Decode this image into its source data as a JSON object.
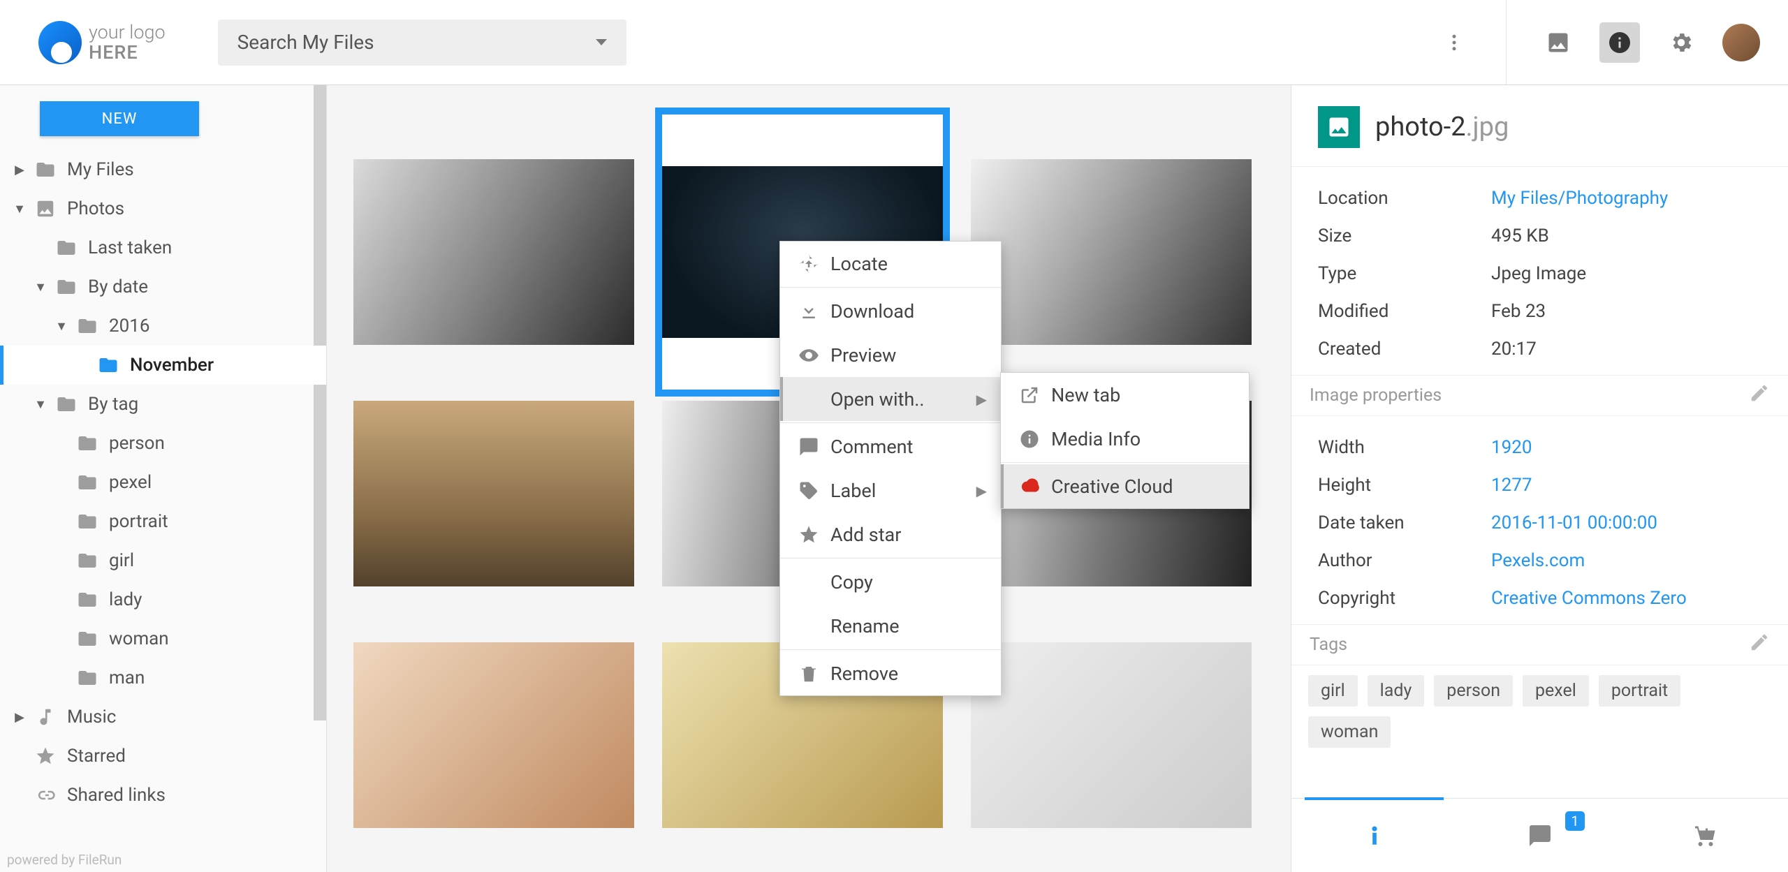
{
  "header": {
    "logo_top": "your logo",
    "logo_bottom": "HERE",
    "search_placeholder": "Search My Files"
  },
  "sidebar": {
    "new_label": "NEW",
    "items": {
      "my_files": "My Files",
      "photos": "Photos",
      "last_taken": "Last taken",
      "by_date": "By date",
      "year_2016": "2016",
      "november": "November",
      "by_tag": "By tag",
      "person": "person",
      "pexel": "pexel",
      "portrait": "portrait",
      "girl": "girl",
      "lady": "lady",
      "woman": "woman",
      "man": "man",
      "music": "Music",
      "starred": "Starred",
      "shared": "Shared links"
    },
    "powered": "powered by FileRun"
  },
  "context_menu": {
    "locate": "Locate",
    "download": "Download",
    "preview": "Preview",
    "open_with": "Open with..",
    "comment": "Comment",
    "label": "Label",
    "add_star": "Add star",
    "copy": "Copy",
    "rename": "Rename",
    "remove": "Remove"
  },
  "submenu": {
    "new_tab": "New tab",
    "media_info": "Media Info",
    "creative_cloud": "Creative Cloud"
  },
  "details": {
    "file_name": "photo-2",
    "file_ext": ".jpg",
    "fields": {
      "location_k": "Location",
      "location_v": "My Files/Photography",
      "size_k": "Size",
      "size_v": "495 KB",
      "type_k": "Type",
      "type_v": "Jpeg Image",
      "modified_k": "Modified",
      "modified_v": "Feb 23",
      "created_k": "Created",
      "created_v": "20:17"
    },
    "image_props_h": "Image properties",
    "img": {
      "width_k": "Width",
      "width_v": "1920",
      "height_k": "Height",
      "height_v": "1277",
      "date_k": "Date taken",
      "date_v": "2016-11-01 00:00:00",
      "author_k": "Author",
      "author_v": "Pexels.com",
      "copy_k": "Copyright",
      "copy_v": "Creative Commons Zero"
    },
    "tags_h": "Tags",
    "tags": {
      "t1": "girl",
      "t2": "lady",
      "t3": "person",
      "t4": "pexel",
      "t5": "portrait",
      "t6": "woman"
    },
    "comment_badge": "1"
  }
}
